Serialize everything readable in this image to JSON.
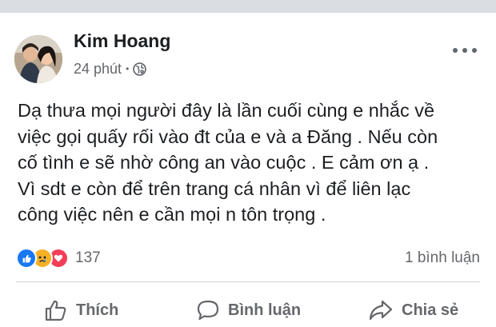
{
  "post": {
    "author": "Kim Hoang",
    "timestamp": "24 phút",
    "privacy_icon": "globe-icon",
    "more_icon": "more-options-icon",
    "text_lines": [
      "Dạ thưa mọi người đây là lần cuối cùng e nhắc về",
      "việc gọi quấy rối vào đt của e và a Đăng . Nếu còn",
      "cố tình e sẽ nhờ công an vào cuộc . E cảm ơn ạ .",
      "Vì sdt e còn để trên trang cá nhân vì để liên lạc",
      "công việc nên e cần mọi n tôn trọng ."
    ]
  },
  "reactions": {
    "icons": [
      "like-reaction-icon",
      "sad-reaction-icon",
      "love-reaction-icon"
    ],
    "count": "137",
    "comments": "1 bình luận"
  },
  "actions": {
    "like": "Thích",
    "comment": "Bình luận",
    "share": "Chia sẻ"
  },
  "colors": {
    "secondary_text": "#65676b",
    "primary_text": "#1c1e21",
    "like_blue": "#1877f2",
    "love_red": "#f33e58",
    "sad_yellow": "#f7b125"
  }
}
